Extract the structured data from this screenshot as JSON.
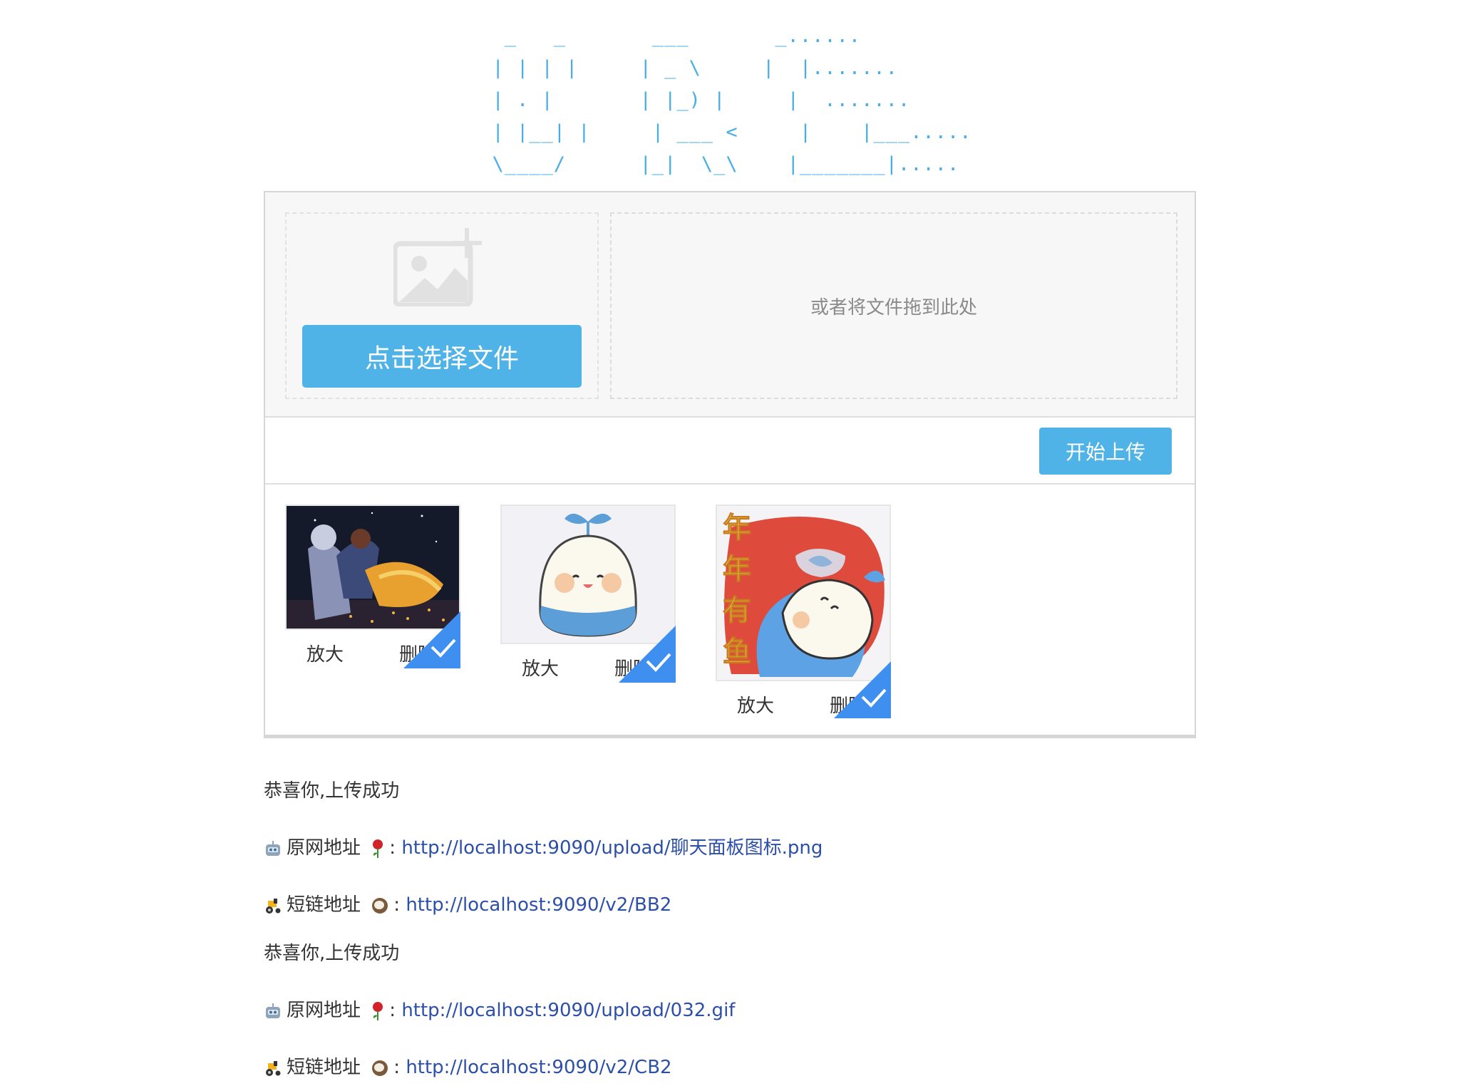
{
  "logo": {
    "ascii": " _   _       ___       _......\n| | | |     | _ \\     |  |.......\n| . |       | |_) |     |  .......\n| |__| |     | ___ <     |    |___.....\n\\____/      |_|  \\_\\    |_______|....."
  },
  "uploader": {
    "pick_button_label": "点击选择文件",
    "drop_hint": "或者将文件拖到此处",
    "upload_button_label": "开始上传",
    "files": [
      {
        "zoom_label": "放大",
        "delete_label": "删除",
        "status": "uploaded"
      },
      {
        "zoom_label": "放大",
        "delete_label": "删除",
        "status": "uploaded"
      },
      {
        "zoom_label": "放大",
        "delete_label": "删除",
        "status": "uploaded",
        "thumb_text": "年年有鱼"
      }
    ]
  },
  "results": [
    {
      "success_text": "恭喜你,上传成功",
      "original_label": "原网地址",
      "original_url": "http://localhost:9090/upload/聊天面板图标.png",
      "short_label": "短链地址",
      "short_url": "http://localhost:9090/v2/BB2"
    },
    {
      "success_text": "恭喜你,上传成功",
      "original_label": "原网地址",
      "original_url": "http://localhost:9090/upload/032.gif",
      "short_label": "短链地址",
      "short_url": "http://localhost:9090/v2/CB2"
    }
  ],
  "colors": {
    "accent": "#4fb3e8",
    "logo": "#4aaee6",
    "link": "#2c4fa8",
    "check_badge": "#3e8ff0"
  },
  "icons": {
    "pick": "image-add-icon",
    "check": "check-corner-icon",
    "original": "robot-emoji-icon",
    "rose": "rose-emoji-icon",
    "short": "tractor-emoji-icon",
    "coconut": "coconut-emoji-icon"
  }
}
